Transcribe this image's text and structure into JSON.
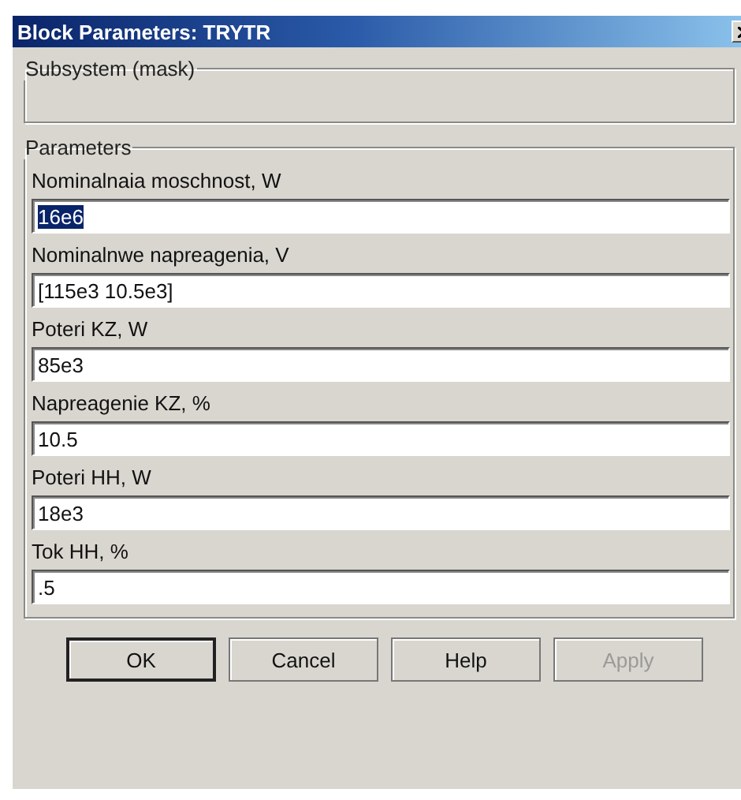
{
  "window": {
    "title": "Block Parameters: TRYTR"
  },
  "description_group": {
    "title": "Subsystem (mask)"
  },
  "parameters_group": {
    "title": "Parameters",
    "fields": [
      {
        "label": "Nominalnaia moschnost, W",
        "value": "16e6",
        "selected": true
      },
      {
        "label": "Nominalnwe napreagenia, V",
        "value": "[115e3 10.5e3]",
        "selected": false
      },
      {
        "label": "Poteri KZ, W",
        "value": "85e3",
        "selected": false
      },
      {
        "label": "Napreagenie KZ, %",
        "value": "10.5",
        "selected": false
      },
      {
        "label": "Poteri HH, W",
        "value": "18e3",
        "selected": false
      },
      {
        "label": "Tok HH, %",
        "value": ".5",
        "selected": false
      }
    ]
  },
  "buttons": [
    {
      "label": "OK",
      "disabled": false,
      "default": true
    },
    {
      "label": "Cancel",
      "disabled": false,
      "default": false
    },
    {
      "label": "Help",
      "disabled": false,
      "default": false
    },
    {
      "label": "Apply",
      "disabled": true,
      "default": false
    }
  ]
}
